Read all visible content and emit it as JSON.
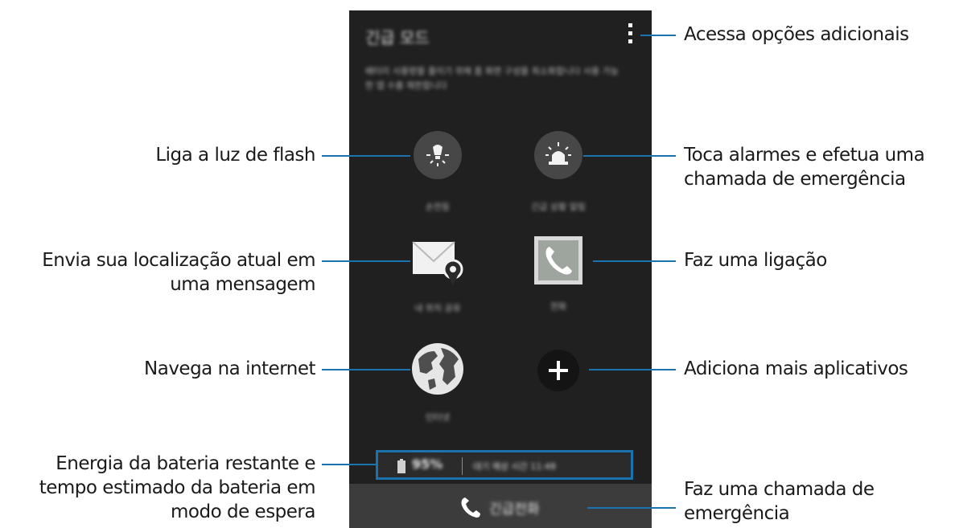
{
  "phone": {
    "title": "긴급 모드",
    "description": "배터리 사용량을 줄이기 위해 홈 화면 구성을 최소화합니다 사용 가능한 앱 수를 제한합니다",
    "apps": {
      "flashlight_label": "손전등",
      "alarm_label": "긴급 상황 알림",
      "location_label": "내 위치 공유",
      "phone_label": "전화",
      "internet_label": "인터넷"
    },
    "battery": {
      "percent": "95%",
      "standby": "대기 예상 시간 11:48"
    },
    "emergency_call_label": "긴급전화"
  },
  "callouts": {
    "more_options": "Acessa opções adicionais",
    "flash": "Liga a luz de flash",
    "alarm_l1": "Toca alarmes e efetua uma",
    "alarm_l2": "chamada de emergência",
    "location_l1": "Envia sua localização atual em",
    "location_l2": "uma mensagem",
    "call": "Faz uma ligação",
    "internet": "Navega na internet",
    "add": "Adiciona mais aplicativos",
    "battery_l1": "Energia da bateria restante e",
    "battery_l2": "tempo estimado da bateria em",
    "battery_l3": "modo de espera",
    "emergency_l1": "Faz uma chamada de",
    "emergency_l2": "emergência"
  },
  "colors": {
    "leader_line": "#1b73ad",
    "phone_bg": "#202020",
    "bottom_bar": "#3c3c3c"
  }
}
